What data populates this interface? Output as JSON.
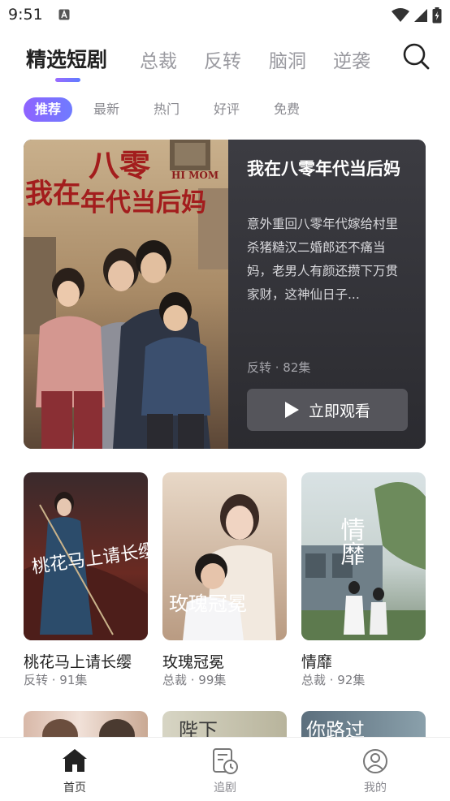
{
  "status": {
    "time": "9:51"
  },
  "tabs": [
    {
      "label": "精选短剧",
      "active": true
    },
    {
      "label": "总裁"
    },
    {
      "label": "反转"
    },
    {
      "label": "脑洞"
    },
    {
      "label": "逆袭"
    }
  ],
  "chips": [
    {
      "label": "推荐",
      "active": true
    },
    {
      "label": "最新"
    },
    {
      "label": "热门"
    },
    {
      "label": "好评"
    },
    {
      "label": "免费"
    }
  ],
  "hero": {
    "poster_text_line1": "八零",
    "poster_text_line2": "我在",
    "poster_text_line3": "年代当后妈",
    "poster_subtext": "HI MOM",
    "title": "我在八零年代当后妈",
    "description": "意外重回八零年代嫁给村里杀猪糙汉二婚郎还不痛当妈，老男人有颜还攒下万贯家财，这神仙日子...",
    "meta": "反转 · 82集",
    "watch_label": "立即观看"
  },
  "cards": [
    {
      "title": "桃花马上请长缨",
      "meta": "反转 · 91集",
      "poster_text": "桃花马上请长缨"
    },
    {
      "title": "玫瑰冠冕",
      "meta": "总裁 · 99集",
      "poster_text": "玫瑰冠冕"
    },
    {
      "title": "情靡",
      "meta": "总裁 · 92集",
      "poster_text": "情靡"
    }
  ],
  "row2_posters": [
    "",
    "陛下",
    "你路过"
  ],
  "bottom_nav": [
    {
      "label": "首页",
      "icon": "home-icon",
      "active": true
    },
    {
      "label": "追剧",
      "icon": "history-icon"
    },
    {
      "label": "我的",
      "icon": "profile-icon"
    }
  ]
}
